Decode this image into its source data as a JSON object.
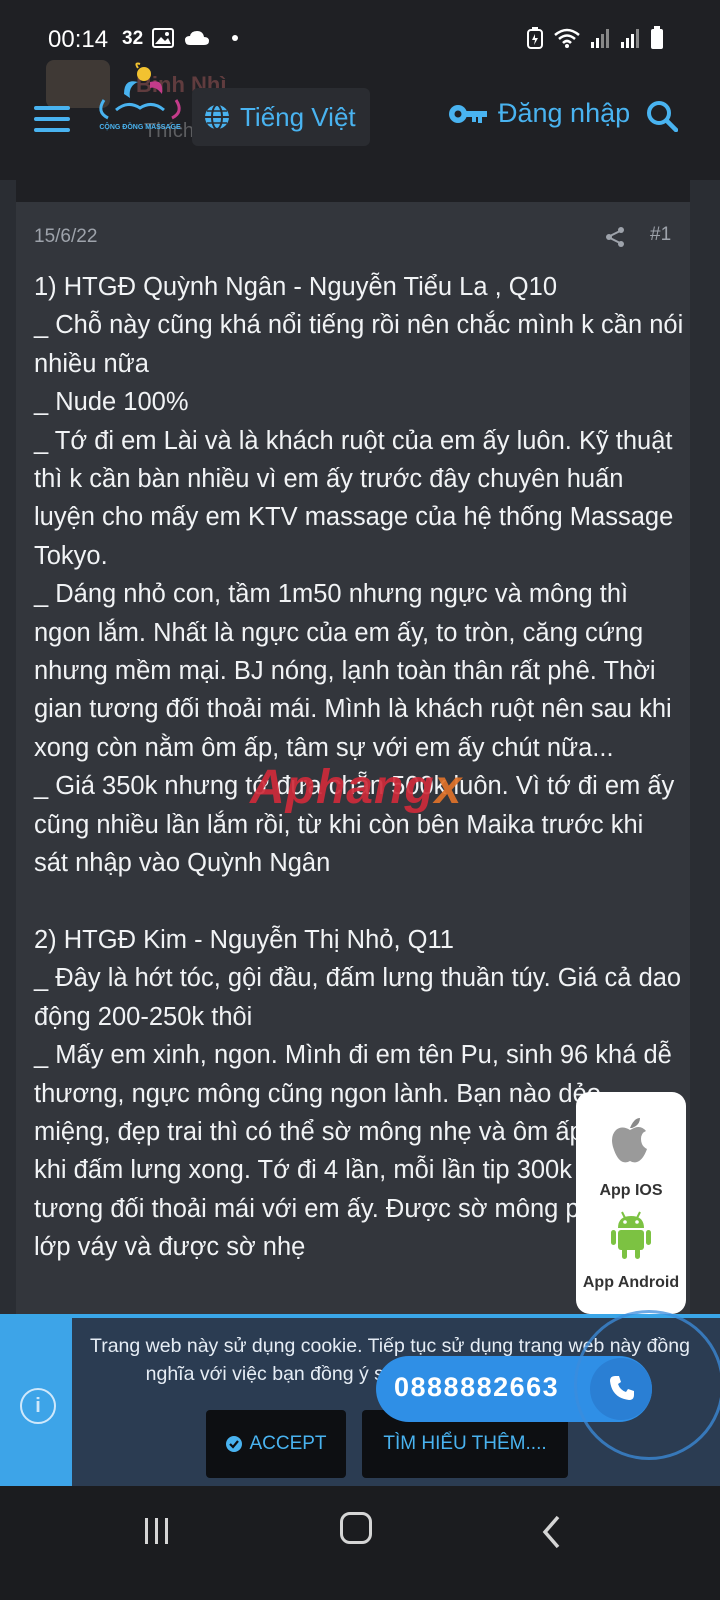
{
  "status_bar": {
    "time": "00:14",
    "notification_count": "32",
    "icons_left": [
      "image-icon",
      "cloud-icon",
      "dot-icon"
    ],
    "icons_right": [
      "battery-saver-icon",
      "wifi-icon",
      "signal-icon",
      "signal-icon-2",
      "battery-icon"
    ]
  },
  "header": {
    "faded_username": "Binh Nhì",
    "faded_subtitle": "Thích Massage",
    "logo_text": "CỘNG ĐỒNG MASSAGE",
    "logo_tagline": "Nâng Niu Gìn Chính Việt",
    "language_label": "Tiếng Việt",
    "login_label": "Đăng nhập"
  },
  "post": {
    "date": "15/6/22",
    "number": "#1",
    "lines": [
      "1) HTGĐ Quỳnh Ngân - Nguyễn Tiểu La , Q10",
      "_ Chỗ này cũng khá nổi tiếng rồi nên chắc mình k cần nói nhiều nữa",
      "_ Nude 100%",
      "_ Tớ đi em Lài và là khách ruột của em ấy luôn. Kỹ thuật thì k cần bàn nhiều vì em ấy trước đây chuyên huấn luyện cho mấy em KTV massage của hệ thống Massage Tokyo.",
      "_ Dáng nhỏ con, tầm 1m50 nhưng ngực và mông thì ngon lắm. Nhất là ngực của em ấy, to tròn, căng cứng nhưng mềm mại. BJ nóng, lạnh toàn thân rất phê. Thời gian tương đối thoải mái. Mình là khách ruột nên sau khi xong còn nằm ôm ấp, tâm sự với em ấy chút nữa...",
      "_ Giá 350k nhưng tớ đưa chẵn 500k luôn. Vì tớ đi em ấy cũng nhiều lần lắm rồi, từ khi còn bên Maika trước khi sát nhập vào Quỳnh Ngân",
      "",
      "2) HTGĐ Kim - Nguyễn Thị Nhỏ, Q11",
      "_ Đây là hớt tóc, gội đầu, đấm lưng thuần túy. Giá cả dao động 200-250k thôi",
      "_ Mấy em xinh, ngon. Mình đi em tên Pu, sinh 96 khá dễ thương, ngực mông cũng ngon lành. Bạn nào dẻo miệng, đẹp trai thì có thể sờ mông nhẹ và ôm ấp chút xíu khi đấm lưng xong. Tớ đi 4 lần, mỗi lần tip 300k nên tương đối thoải mái với em ấy. Được sờ mông phía sau lớp váy và được sờ nhẹ"
    ]
  },
  "watermark": {
    "main": "Aphang",
    "accent": "x"
  },
  "app_card": {
    "ios_label": "App IOS",
    "android_label": "App Android"
  },
  "cookie": {
    "text": "Trang web này sử dụng cookie. Tiếp tục sử dụng trang web này đồng nghĩa với việc bạn đồng ý sử dụng cookie của chúng tôi.",
    "accept_label": "ACCEPT",
    "learn_more_label": "TÌM HIỂU THÊM...."
  },
  "phone": {
    "number": "0888882663"
  },
  "colors": {
    "accent": "#49b3f0",
    "background": "#2a2d33",
    "post_background": "#33363c",
    "cookie_background": "#2b3c52",
    "phone_button": "#2f8fe6",
    "watermark": "#cf2b3a"
  }
}
